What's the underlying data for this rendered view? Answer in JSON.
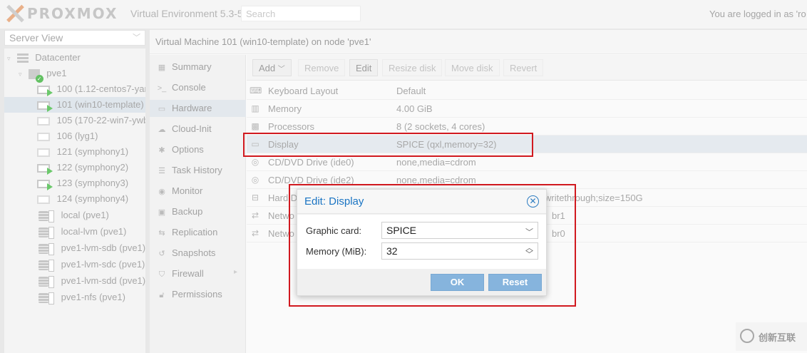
{
  "header": {
    "logo_text": "PROXMOX",
    "version": "Virtual Environment 5.3-5",
    "search_placeholder": "Search",
    "login_text": "You are logged in as 'ro"
  },
  "sidebar": {
    "view": "Server View",
    "tree": [
      {
        "label": "Datacenter",
        "icon": "datacenter-icon"
      },
      {
        "label": "pve1",
        "icon": "node-icon"
      },
      {
        "label": "100 (1.12-centos7-yar",
        "icon": "vm-running-icon"
      },
      {
        "label": "101 (win10-template)",
        "icon": "vm-running-icon",
        "selected": true
      },
      {
        "label": "105 (170-22-win7-ywb",
        "icon": "vm-stopped-icon"
      },
      {
        "label": "106 (lyg1)",
        "icon": "vm-stopped-icon"
      },
      {
        "label": "121 (symphony1)",
        "icon": "vm-stopped-icon"
      },
      {
        "label": "122 (symphony2)",
        "icon": "vm-running-icon"
      },
      {
        "label": "123 (symphony3)",
        "icon": "vm-running-icon"
      },
      {
        "label": "124 (symphony4)",
        "icon": "vm-stopped-icon"
      },
      {
        "label": "local (pve1)",
        "icon": "storage-icon"
      },
      {
        "label": "local-lvm (pve1)",
        "icon": "storage-icon"
      },
      {
        "label": "pve1-lvm-sdb (pve1)",
        "icon": "storage-icon"
      },
      {
        "label": "pve1-lvm-sdc (pve1)",
        "icon": "storage-icon"
      },
      {
        "label": "pve1-lvm-sdd (pve1)",
        "icon": "storage-icon"
      },
      {
        "label": "pve1-nfs (pve1)",
        "icon": "storage-icon"
      }
    ]
  },
  "main": {
    "breadcrumb": "Virtual Machine 101 (win10-template) on node 'pve1'",
    "nav": [
      {
        "label": "Summary",
        "icon": "summary-icon"
      },
      {
        "label": "Console",
        "icon": "console-icon"
      },
      {
        "label": "Hardware",
        "icon": "hardware-icon",
        "selected": true
      },
      {
        "label": "Cloud-Init",
        "icon": "cloud-icon"
      },
      {
        "label": "Options",
        "icon": "gear-icon"
      },
      {
        "label": "Task History",
        "icon": "list-icon"
      },
      {
        "label": "Monitor",
        "icon": "eye-icon"
      },
      {
        "label": "Backup",
        "icon": "floppy-icon"
      },
      {
        "label": "Replication",
        "icon": "retweet-icon"
      },
      {
        "label": "Snapshots",
        "icon": "history-icon"
      },
      {
        "label": "Firewall",
        "icon": "shield-icon"
      },
      {
        "label": "Permissions",
        "icon": "unlock-icon"
      }
    ],
    "toolbar": {
      "add": "Add",
      "remove": "Remove",
      "edit": "Edit",
      "resize_disk": "Resize disk",
      "move_disk": "Move disk",
      "revert": "Revert"
    },
    "hardware": [
      {
        "key": "Keyboard Layout",
        "value": "Default",
        "icon": "keyboard-icon"
      },
      {
        "key": "Memory",
        "value": "4.00 GiB",
        "icon": "memory-icon"
      },
      {
        "key": "Processors",
        "value": "8 (2 sockets, 4 cores)",
        "icon": "cpu-icon"
      },
      {
        "key": "Display",
        "value": "SPICE (qxl,memory=32)",
        "icon": "monitor-icon",
        "selected": true
      },
      {
        "key": "CD/DVD Drive (ide0)",
        "value": "none,media=cdrom",
        "icon": "cdrom-icon"
      },
      {
        "key": "CD/DVD Drive (ide2)",
        "value": "none,media=cdrom",
        "icon": "cdrom-icon"
      },
      {
        "key": "Hard D",
        "value": "writethrough;size=150G",
        "icon": "hdd-icon"
      },
      {
        "key": "Netwo",
        "value": "br1",
        "icon": "network-icon"
      },
      {
        "key": "Netwo",
        "value": "br0",
        "icon": "network-icon"
      }
    ]
  },
  "dialog": {
    "title": "Edit: Display",
    "graphic_card_label": "Graphic card:",
    "graphic_card_value": "SPICE",
    "memory_label": "Memory (MiB):",
    "memory_value": "32",
    "ok": "OK",
    "reset": "Reset"
  },
  "watermark": {
    "text": "创新互联"
  },
  "colors": {
    "highlight": "#d1191f",
    "accent": "#1a74c3",
    "button": "#86b4dd"
  }
}
